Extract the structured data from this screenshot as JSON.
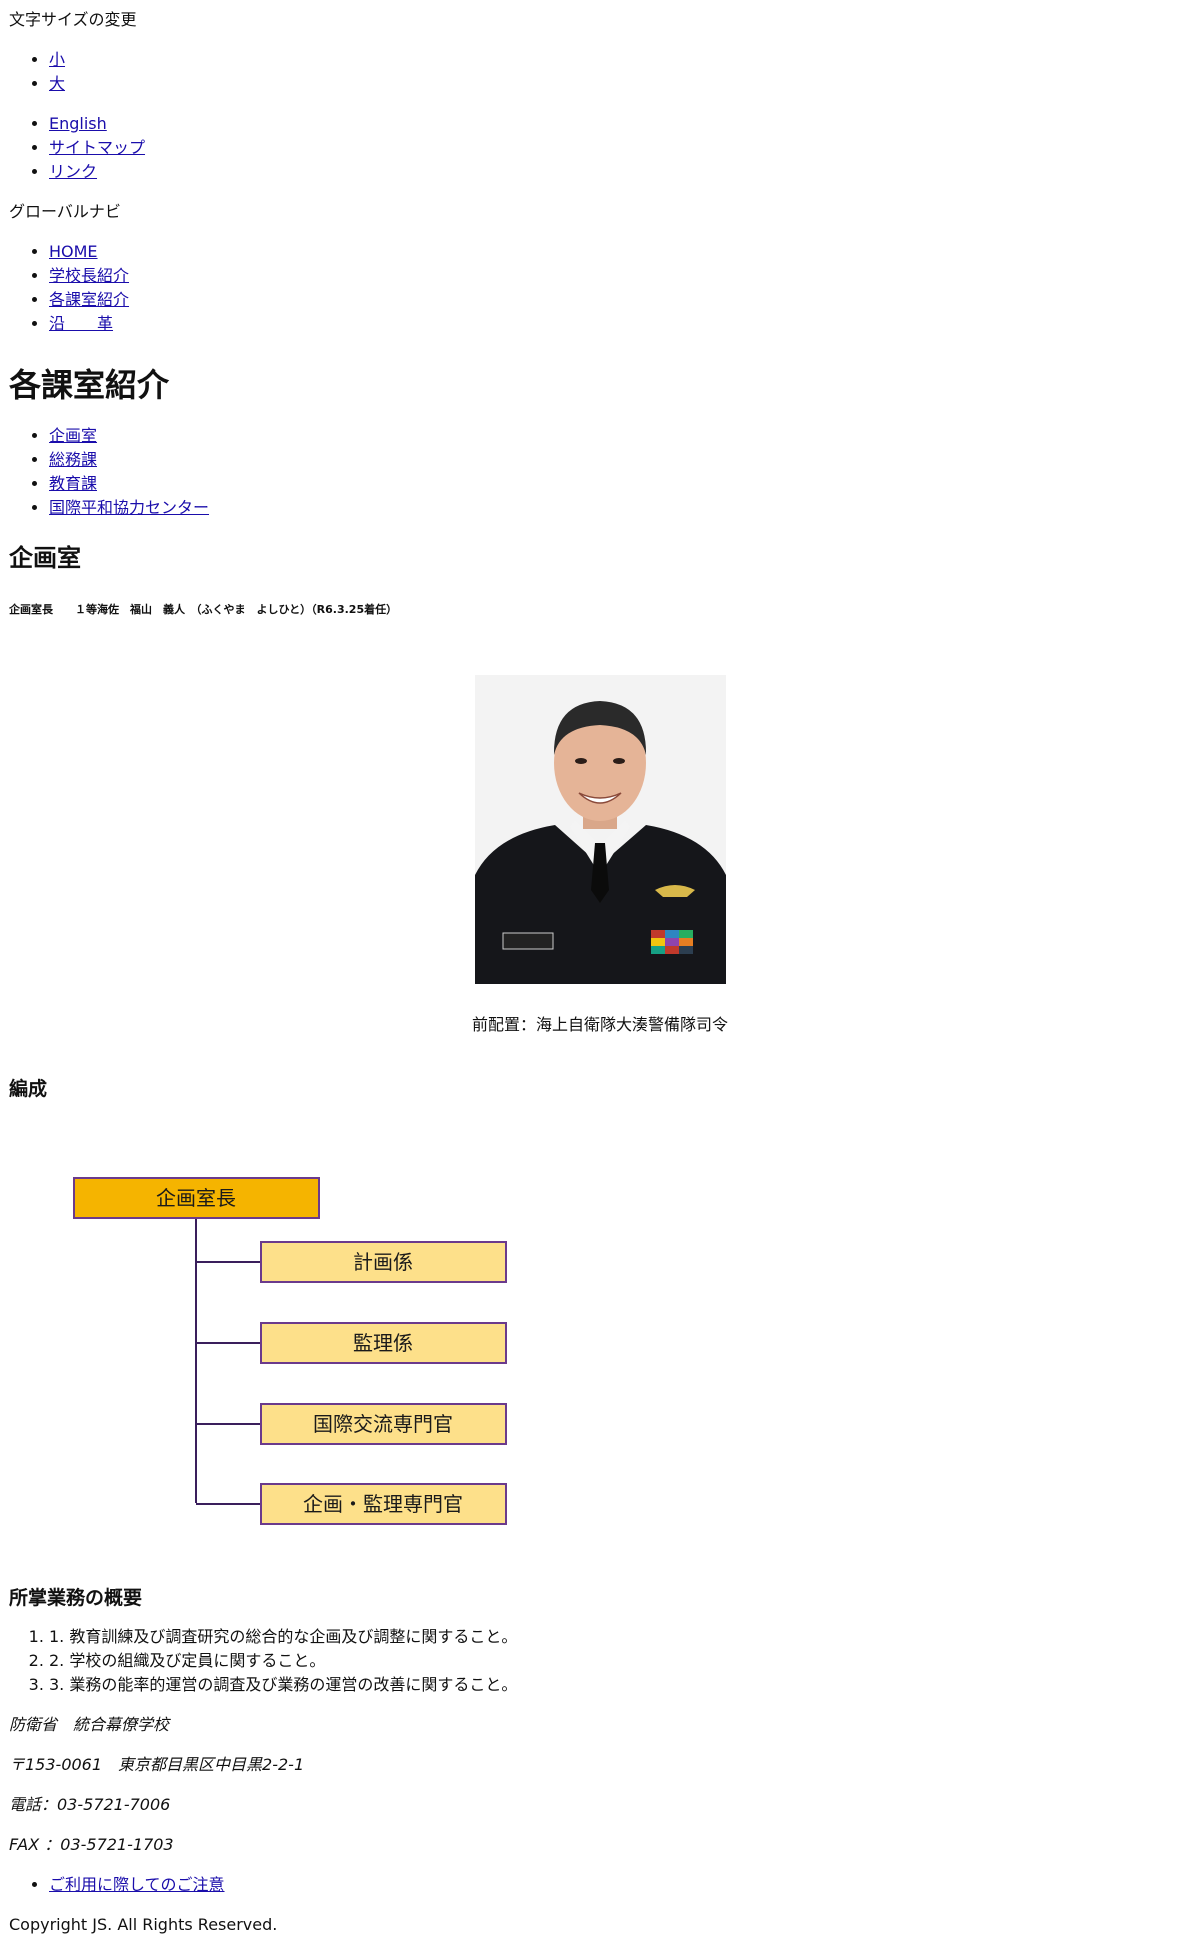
{
  "font_size": {
    "label": "文字サイズの変更",
    "options": [
      "小",
      "大"
    ]
  },
  "utility_nav": {
    "items": [
      "English",
      "サイトマップ",
      "リンク"
    ]
  },
  "global_nav": {
    "label": "グローバルナビ",
    "items": [
      "HOME",
      "学校長紹介",
      "各課室紹介",
      "沿　　革"
    ]
  },
  "page": {
    "title": "各課室紹介",
    "sub_nav": [
      "企画室",
      "総務課",
      "教育課",
      "国際平和協力センター"
    ]
  },
  "section": {
    "title": "企画室",
    "chief_line": "企画室長　　１等海佐　福山　義人　（ふくやま　よしひと）（R6.3.25着任）",
    "photo_caption": "前配置：海上自衛隊大湊警備隊司令",
    "org_heading": "編成",
    "org_chart": {
      "root": "企画室長",
      "children": [
        "計画係",
        "監理係",
        "国際交流専門官",
        "企画・監理専門官"
      ],
      "colors": {
        "root_fill": "#f5b400",
        "child_fill": "#fde08a",
        "border": "#6b3a8c"
      }
    },
    "duties_heading": "所掌業務の概要",
    "duties": [
      "1. 教育訓練及び調査研究の総合的な企画及び調整に関すること。",
      "2. 学校の組織及び定員に関すること。",
      "3. 業務の能率的運営の調査及び業務の運営の改善に関すること。"
    ]
  },
  "footer": {
    "org": "防衛省　統合幕僚学校",
    "address": "〒153-0061　東京都目黒区中目黒2-2-1",
    "phone": "電話：03-5721-7006",
    "fax": "FAX ：03-5721-1703",
    "links": [
      "ご利用に際してのご注意"
    ],
    "copyright": "Copyright JS. All Rights Reserved."
  },
  "colors": {
    "link": "#1a0dab",
    "text": "#111111"
  }
}
